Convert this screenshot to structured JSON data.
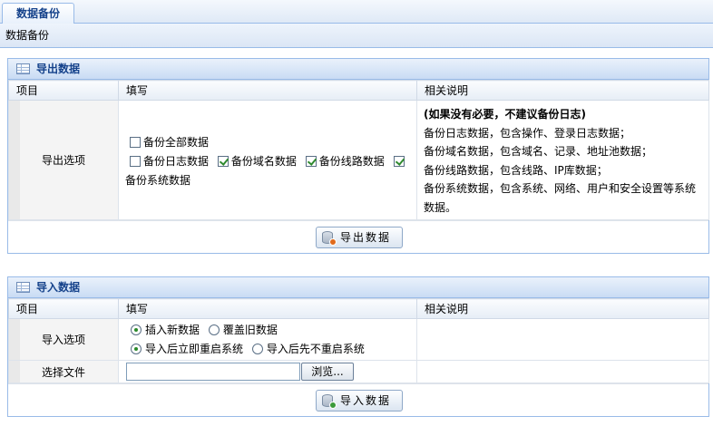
{
  "tabbar": {
    "active_tab": "数据备份"
  },
  "subbar": {
    "breadcrumb": "数据备份"
  },
  "export": {
    "title": "导出数据",
    "headers": {
      "item": "项目",
      "fill": "填写",
      "desc": "相关说明"
    },
    "row_label": "导出选项",
    "options": {
      "all": "备份全部数据",
      "log": "备份日志数据",
      "domain": "备份域名数据",
      "route": "备份线路数据",
      "system": "备份系统数据"
    },
    "notes": [
      "(如果没有必要，不建议备份日志)",
      "备份日志数据，包含操作、登录日志数据；",
      "备份域名数据，包含域名、记录、地址池数据；",
      "备份线路数据，包含线路、IP库数据；",
      "备份系统数据，包含系统、网络、用户和安全设置等系统",
      "数据。"
    ],
    "button": "导出数据"
  },
  "import": {
    "title": "导入数据",
    "headers": {
      "item": "项目",
      "fill": "填写",
      "desc": "相关说明"
    },
    "row_label": "导入选项",
    "options": {
      "insert_new": "插入新数据",
      "overwrite_old": "覆盖旧数据",
      "reboot_now": "导入后立即重启系统",
      "no_reboot": "导入后先不重启系统"
    },
    "file_label": "选择文件",
    "browse_button": "浏览...",
    "button": "导入数据"
  },
  "colors": {
    "panel_border": "#99bbe8",
    "title_text": "#15428b",
    "check_green": "#2f8a2f",
    "icon_badge": "#e06a1b"
  }
}
